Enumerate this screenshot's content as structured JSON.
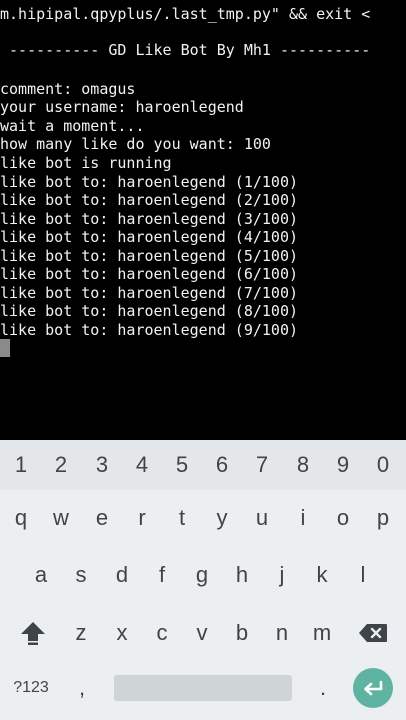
{
  "terminal": {
    "lines": [
      "m.hipipal.qpyplus/.last_tmp.py\" && exit <",
      "",
      " ---------- GD Like Bot By Mh1 ----------",
      "",
      "comment: omagus",
      "your username: haroenlegend",
      "wait a moment...",
      "how many like do you want: 100",
      "like bot is running",
      "like bot to: haroenlegend (1/100)",
      "like bot to: haroenlegend (2/100)",
      "like bot to: haroenlegend (3/100)",
      "like bot to: haroenlegend (4/100)",
      "like bot to: haroenlegend (5/100)",
      "like bot to: haroenlegend (6/100)",
      "like bot to: haroenlegend (7/100)",
      "like bot to: haroenlegend (8/100)",
      "like bot to: haroenlegend (9/100)"
    ]
  },
  "keyboard": {
    "number_row": [
      "1",
      "2",
      "3",
      "4",
      "5",
      "6",
      "7",
      "8",
      "9",
      "0"
    ],
    "row1": [
      "q",
      "w",
      "e",
      "r",
      "t",
      "y",
      "u",
      "i",
      "o",
      "p"
    ],
    "row2": [
      "a",
      "s",
      "d",
      "f",
      "g",
      "h",
      "j",
      "k",
      "l"
    ],
    "row3": [
      "z",
      "x",
      "c",
      "v",
      "b",
      "n",
      "m"
    ],
    "symbols_label": "?123",
    "comma": ",",
    "period": ".",
    "icons": {
      "shift": "shift-icon",
      "backspace": "backspace-icon",
      "enter": "enter-icon"
    }
  },
  "colors": {
    "terminal_bg": "#000000",
    "terminal_text": "#f2f2f2",
    "keyboard_bg": "#eceff1",
    "key_text": "#3f4448",
    "enter_accent": "#5fb3a3"
  }
}
